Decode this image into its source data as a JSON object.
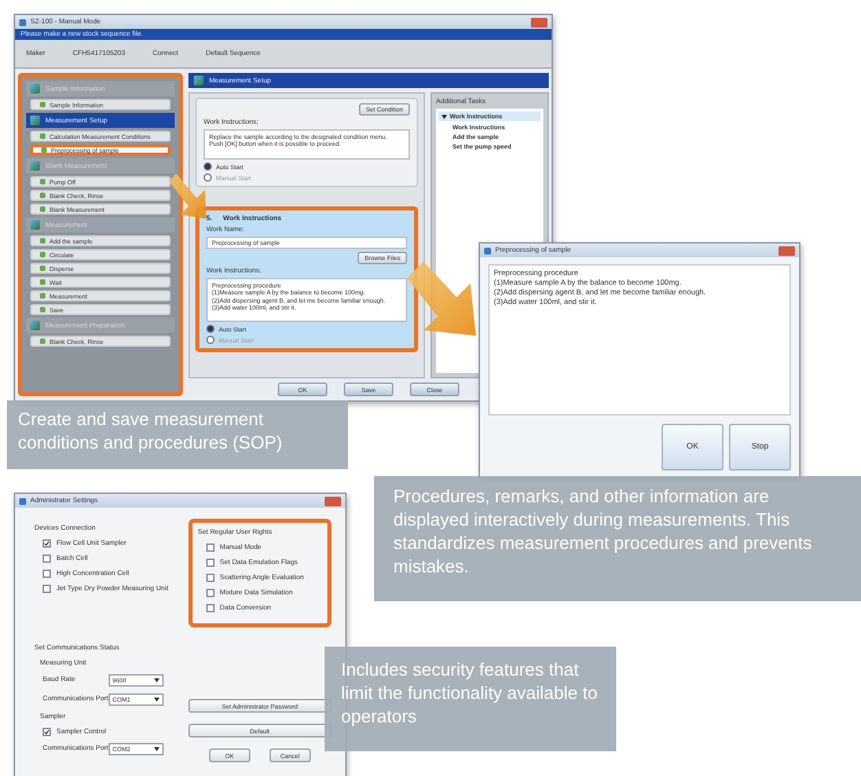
{
  "main_window": {
    "title": "SZ-100 - Manual Mode",
    "banner": "Please make a new stock sequence file.",
    "toolbar": [
      "Maker",
      "CFH5417105203",
      "Connect",
      "Default Sequence"
    ],
    "sidebar": {
      "highlighted": true,
      "groups": [
        {
          "label": "Sample Information",
          "selected": false,
          "items": [
            {
              "label": "Sample Information",
              "selected": false
            }
          ]
        },
        {
          "label": "Measurement Setup",
          "selected": true,
          "items": [
            {
              "label": "Calculation Measurement Conditions",
              "selected": false
            },
            {
              "label": "Preprocessing of sample",
              "selected": true
            }
          ]
        },
        {
          "label": "Blank Measurement",
          "selected": false,
          "items": [
            {
              "label": "Pump Off",
              "selected": false
            },
            {
              "label": "Blank Check, Rinse",
              "selected": false
            },
            {
              "label": "Blank Measurement",
              "selected": false
            }
          ]
        },
        {
          "label": "Measurement",
          "selected": false,
          "items": [
            {
              "label": "Add the sample",
              "selected": false
            },
            {
              "label": "Circulate",
              "selected": false
            },
            {
              "label": "Disperse",
              "selected": false
            },
            {
              "label": "Wait",
              "selected": false
            },
            {
              "label": "Measurement",
              "selected": false
            },
            {
              "label": "Save",
              "selected": false
            }
          ]
        },
        {
          "label": "Measurement Preparation",
          "selected": false,
          "items": [
            {
              "label": "Blank Check, Rinse",
              "selected": false
            }
          ]
        }
      ]
    },
    "panel_title": "Measurement Setup",
    "steps": [
      {
        "kind": "partial",
        "highlighted": false,
        "button": "Set Condition",
        "instructions_label": "Work Instructions:",
        "instructions": "Replace the sample according to the designated condition menu.\nPush [OK] button when it is possible to proceed.",
        "options": [
          {
            "label": "Auto Start",
            "selected": true
          },
          {
            "label": "Manual Start",
            "selected": false
          }
        ]
      },
      {
        "kind": "full",
        "highlighted": true,
        "number": "5.",
        "title": "Work Instructions",
        "name_label": "Work Name:",
        "name": "Preprocessing of sample",
        "button": "Browse Files",
        "instructions_label": "Work Instructions:",
        "instructions": "Preprocessing procedure\n(1)Measure sample A by the balance to become 100mg.\n(2)Add dispersing agent B, and let me become familiar enough.\n(3)Add water 100ml, and stir it.",
        "options": [
          {
            "label": "Auto Start",
            "selected": true
          },
          {
            "label": "Manual Start",
            "selected": false
          }
        ]
      }
    ],
    "footer_buttons": [
      "OK",
      "Save",
      "Close"
    ],
    "tasks": {
      "title": "Additional Tasks",
      "items": [
        {
          "label": "Work Instructions",
          "expanded": true,
          "children": [
            {
              "label": "Work Instructions"
            },
            {
              "label": "Add the sample"
            },
            {
              "label": "Set the pump speed"
            }
          ]
        }
      ]
    }
  },
  "sop_callout": "Create and save measurement conditions and procedures (SOP)",
  "dialog": {
    "title": "Preprocessing of sample",
    "text": "Preprocessing procedure\n(1)Measure sample A by the balance to become 100mg.\n(2)Add dispersing agent B, and let me become familiar enough.\n(3)Add water 100ml, and stir it.",
    "buttons": [
      "OK",
      "Stop"
    ]
  },
  "procedure_callout": "Procedures, remarks, and other information are displayed interactively during measurements. This standardizes measurement procedures and prevents mistakes.",
  "admin_window": {
    "title": "Administrator Settings",
    "devices": {
      "title": "Devices Connection",
      "options": [
        {
          "label": "Flow Cell Unit Sampler",
          "checked": true
        },
        {
          "label": "Batch Cell",
          "checked": false
        },
        {
          "label": "High Concentration Cell",
          "checked": false
        },
        {
          "label": "Jet Type Dry Powder Measuring Unit",
          "checked": false
        }
      ]
    },
    "rights": {
      "title": "Set Regular User Rights",
      "highlighted": true,
      "options": [
        {
          "label": "Manual Mode",
          "checked": false
        },
        {
          "label": "Set Data Emulation Flags",
          "checked": false
        },
        {
          "label": "Scattering Angle Evaluation",
          "checked": false
        },
        {
          "label": "Mixture Data Simulation",
          "checked": false
        },
        {
          "label": "Data Conversion",
          "checked": false
        }
      ]
    },
    "comms": {
      "title": "Set Communications Status",
      "unit_label": "Measuring Unit",
      "baud_label": "Baud Rate",
      "baud": "9600",
      "port_label": "Communications Port",
      "port": "COM1",
      "sampler_label": "Sampler",
      "sampler_control": {
        "label": "Sampler Control",
        "checked": true
      },
      "sampler_port_label": "Communications Port",
      "sampler_port": "COM2"
    },
    "buttons": [
      "Set Administrator Password",
      "Default"
    ],
    "footer_buttons": [
      "OK",
      "Cancel"
    ]
  },
  "security_callout": "Includes security features that limit the functionality available to operators"
}
